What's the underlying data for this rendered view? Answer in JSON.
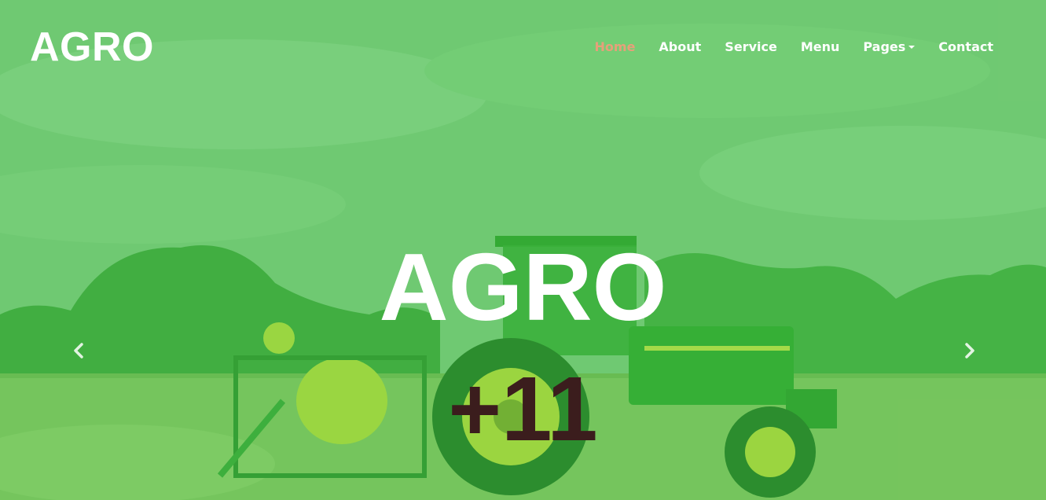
{
  "brand": {
    "name": "AGRO"
  },
  "nav": {
    "items": [
      {
        "label": "Home",
        "active": true
      },
      {
        "label": "About"
      },
      {
        "label": "Service"
      },
      {
        "label": "Menu"
      },
      {
        "label": "Pages",
        "dropdown": true
      },
      {
        "label": "Contact"
      }
    ]
  },
  "hero": {
    "title": "AGRO",
    "subtitle": "+11",
    "prev_icon": "chevron-left-icon",
    "next_icon": "chevron-right-icon"
  },
  "colors": {
    "overlay": "#5fc65a",
    "active_nav": "#e6a07a",
    "subtitle": "#3b1d1d",
    "text": "#ffffff"
  }
}
